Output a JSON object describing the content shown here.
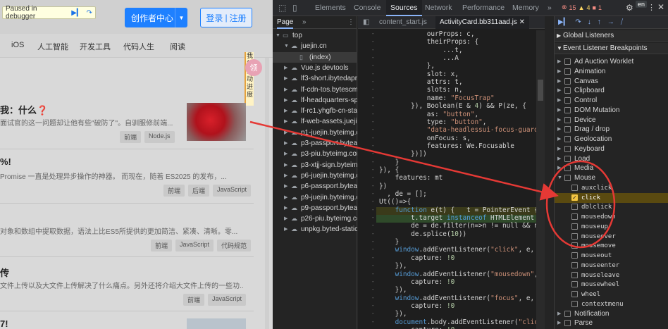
{
  "debugger": {
    "paused_text": "Paused in debugger"
  },
  "site": {
    "creator_center": "创作者中心",
    "login": "登录",
    "separator": "|",
    "register": "注册",
    "nav": [
      "iOS",
      "人工智能",
      "开发工具",
      "代码人生",
      "阅读"
    ],
    "sidebar_vertical": [
      "我",
      "的",
      "活",
      "动",
      "进",
      "度"
    ],
    "badge": "领",
    "articles": [
      {
        "title": "我：什么❓",
        "desc": "面试官的这一问题却让他有些\"破防了\"。自驯服修前端...",
        "tags": [
          "前端",
          "Node.js"
        ]
      },
      {
        "title": "%!",
        "desc": "Promise 一直是处理异步操作的神器。 而现在，随着 ES2025 的发布，...",
        "tags": [
          "前端",
          "后端",
          "JavaScript"
        ]
      },
      {
        "title": "",
        "desc": "对象和数组中提取数据，语法上比ES5所提供的更加简洁、紧凑、清晰。零...",
        "tags": [
          "前端",
          "JavaScript",
          "代码规范"
        ]
      },
      {
        "title": "传",
        "desc": "文件上传以及大文件上传解决了什么痛点。另外还将介绍大文件上传的一些功...",
        "tags": [
          "前端",
          "JavaScript"
        ]
      },
      {
        "title": "7!",
        "desc": "",
        "tags": []
      }
    ]
  },
  "devtools": {
    "tabs": [
      "Elements",
      "Console",
      "Sources",
      "Network",
      "Performance",
      "Memory"
    ],
    "active_tab": "Sources",
    "more": "»",
    "error_count": "15",
    "warning_count": "4",
    "info_count": "1",
    "lang": "en",
    "navigator_tab": "Page",
    "editor_tabs": [
      "content_start.js",
      "ActivityCard.bb311aad.js"
    ],
    "tree": [
      {
        "label": "top",
        "indent": 0,
        "icon": "folder",
        "expanded": true
      },
      {
        "label": "juejin.cn",
        "indent": 1,
        "icon": "cloud",
        "expanded": true
      },
      {
        "label": "(index)",
        "indent": 2,
        "icon": "file",
        "selected": true
      },
      {
        "label": "Vue.js devtools",
        "indent": 1,
        "icon": "cloud"
      },
      {
        "label": "lf3-short.ibytedapm.c",
        "indent": 1,
        "icon": "cloud"
      },
      {
        "label": "lf-cdn-tos.bytescm.co",
        "indent": 1,
        "icon": "cloud"
      },
      {
        "label": "lf-headquarters-spee",
        "indent": 1,
        "icon": "cloud"
      },
      {
        "label": "lf-rc1.yhgfb-cn-static",
        "indent": 1,
        "icon": "cloud"
      },
      {
        "label": "lf-web-assets.juejin.c",
        "indent": 1,
        "icon": "cloud"
      },
      {
        "label": "p1-juejin.byteimg.co",
        "indent": 1,
        "icon": "cloud"
      },
      {
        "label": "p3-passport.byteacc",
        "indent": 1,
        "icon": "cloud"
      },
      {
        "label": "p3-piu.byteimg.com",
        "indent": 1,
        "icon": "cloud"
      },
      {
        "label": "p3-xtjj-sign.byteimg",
        "indent": 1,
        "icon": "cloud"
      },
      {
        "label": "p6-juejin.byteimg.co",
        "indent": 1,
        "icon": "cloud"
      },
      {
        "label": "p6-passport.byteacc",
        "indent": 1,
        "icon": "cloud"
      },
      {
        "label": "p9-juejin.byteimg.co",
        "indent": 1,
        "icon": "cloud"
      },
      {
        "label": "p9-passport.byteacc",
        "indent": 1,
        "icon": "cloud"
      },
      {
        "label": "p26-piu.byteimg.com",
        "indent": 1,
        "icon": "cloud"
      },
      {
        "label": "unpkg.byted-static.co",
        "indent": 1,
        "icon": "cloud"
      }
    ],
    "code": [
      "            ourProps: c,",
      "            theirProps: {",
      "                ...t,",
      "                ...A",
      "            },",
      "            slot: x,",
      "            attrs: t,",
      "            slots: n,",
      "            name: \"FocusTrap\"",
      "        }), Boolean(E & 4) && P(ze, {",
      "            as: \"button\",",
      "            type: \"button\",",
      "            \"data-headlessui-focus-guard\"",
      "            onFocus: s,",
      "            features: We.Focusable",
      "        })])",
      "    }",
      "}), {",
      "    features: mt",
      "})",
      "  , de = [];",
      "Ut(()=>{",
      "    function e(t) {   t = PointerEvent {isTru",
      "        t.target instanceof HTMLElement && t",
      "        de = de.filter(n=>n != null && n.isC",
      "        de.splice(10))",
      "    }",
      "    window.addEventListener(\"click\", e, {",
      "        capture: !0",
      "    }),",
      "    window.addEventListener(\"mousedown\", e,",
      "        capture: !0",
      "    }),",
      "    window.addEventListener(\"focus\", e, {",
      "        capture: !0",
      "    }),",
      "    document.body.addEventListener(\"click\",",
      "        capture: !0"
    ],
    "gutter": [
      "-",
      "-",
      "-",
      "-",
      "-",
      "-",
      "-",
      "-",
      "-",
      "-",
      "-",
      "-",
      "-",
      "-",
      "-",
      "-",
      "-",
      "-",
      "-",
      "-",
      "-",
      "-",
      "-",
      "-",
      "-",
      "-",
      "-",
      "-",
      "-",
      "-",
      "-",
      "-",
      "-",
      "-",
      "-",
      "-",
      "-",
      "-"
    ],
    "sections": {
      "global": "Global Listeners",
      "breakpoints": "Event Listener Breakpoints"
    },
    "breakpoints": [
      {
        "label": "Ad Auction Worklet",
        "level": 0
      },
      {
        "label": "Animation",
        "level": 0
      },
      {
        "label": "Canvas",
        "level": 0
      },
      {
        "label": "Clipboard",
        "level": 0
      },
      {
        "label": "Control",
        "level": 0
      },
      {
        "label": "DOM Mutation",
        "level": 0
      },
      {
        "label": "Device",
        "level": 0
      },
      {
        "label": "Drag / drop",
        "level": 0
      },
      {
        "label": "Geolocation",
        "level": 0
      },
      {
        "label": "Keyboard",
        "level": 0
      },
      {
        "label": "Load",
        "level": 0
      },
      {
        "label": "Media",
        "level": 0
      },
      {
        "label": "Mouse",
        "level": 0,
        "expanded": true
      },
      {
        "label": "auxclick",
        "level": 1
      },
      {
        "label": "click",
        "level": 1,
        "checked": true
      },
      {
        "label": "dblclick",
        "level": 1
      },
      {
        "label": "mousedown",
        "level": 1
      },
      {
        "label": "mouseup",
        "level": 1
      },
      {
        "label": "mouseover",
        "level": 1
      },
      {
        "label": "mousemove",
        "level": 1
      },
      {
        "label": "mouseout",
        "level": 1
      },
      {
        "label": "mouseenter",
        "level": 1
      },
      {
        "label": "mouseleave",
        "level": 1
      },
      {
        "label": "mousewheel",
        "level": 1
      },
      {
        "label": "wheel",
        "level": 1
      },
      {
        "label": "contextmenu",
        "level": 1
      },
      {
        "label": "Notification",
        "level": 0
      },
      {
        "label": "Parse",
        "level": 0
      }
    ],
    "colors": {
      "annotation": "#e53935",
      "accent": "#8ab4f8",
      "checked": "#f4c542"
    }
  }
}
